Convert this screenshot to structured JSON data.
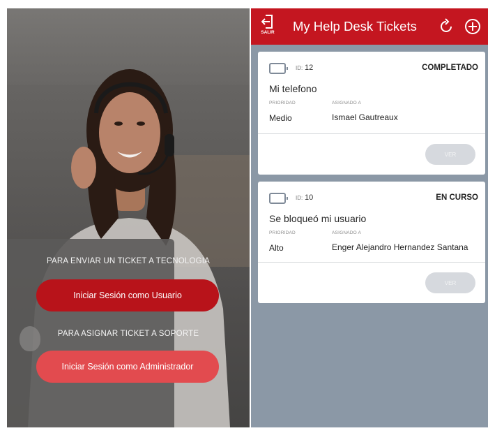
{
  "login": {
    "prompt_user": "PARA ENVIAR UN TICKET A TECNOLOGIA",
    "button_user": "Iniciar Sesión como Usuario",
    "prompt_admin": "PARA ASIGNAR TICKET A SOPORTE",
    "button_admin": "Iniciar Sesión como Administrador"
  },
  "header": {
    "exit_label": "SALIR",
    "title": "My Help Desk Tickets",
    "icons": [
      "exit-icon",
      "refresh-icon",
      "add-icon"
    ]
  },
  "tickets": [
    {
      "id_label": "ID:",
      "id": "12",
      "status": "COMPLETADO",
      "subject": "Mi telefono",
      "priority_label": "PRIORIDAD",
      "priority": "Medio",
      "assigned_label": "ASIGNADO A",
      "assigned": "Ismael Gautreaux",
      "action": "VER"
    },
    {
      "id_label": "ID:",
      "id": "10",
      "status": "EN CURSO",
      "subject": "Se bloqueó mi usuario",
      "priority_label": "PRIORIDAD",
      "priority": "Alto",
      "assigned_label": "ASIGNADO A",
      "assigned": "Enger Alejandro Hernandez Santana",
      "action": "VER"
    }
  ],
  "colors": {
    "brand_red": "#c41620",
    "button_user": "#b8131a",
    "button_admin": "#e24b4f",
    "tickets_bg": "#8b98a6"
  }
}
